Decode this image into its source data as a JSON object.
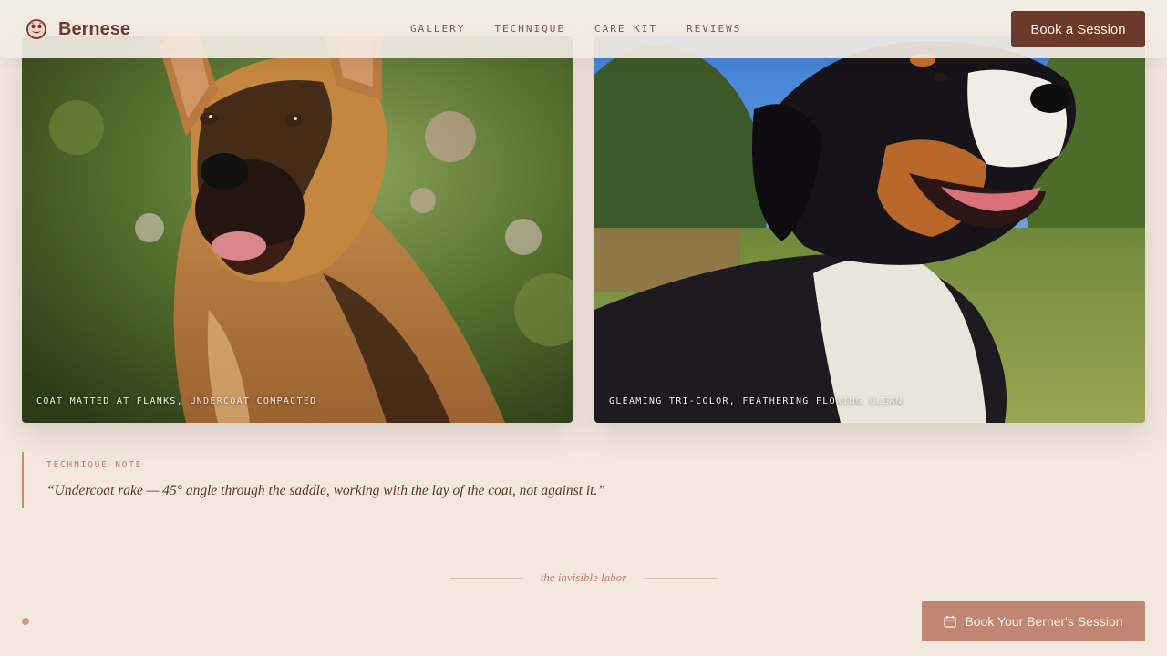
{
  "header": {
    "brand_name": "Bernese",
    "brand_icon": "paw-dog-icon",
    "nav": [
      "GALLERY",
      "TECHNIQUE",
      "CARE KIT",
      "REVIEWS"
    ],
    "book_button": "Book a Session"
  },
  "gallery": {
    "before_caption": "COAT MATTED AT FLANKS, UNDERCOAT COMPACTED",
    "after_caption": "GLEAMING TRI-COLOR, FEATHERING FLOWING CLEAN"
  },
  "technique_note": {
    "label": "TECHNIQUE NOTE",
    "quote": "“Undercoat rake — 45° angle through the saddle, working with the lay of the coat, not against it.”"
  },
  "divider": {
    "text": "the invisible labor"
  },
  "cta": {
    "label": "Book Your Berner's Session",
    "icon": "calendar-icon"
  },
  "colors": {
    "background": "#f2e8de",
    "brand": "#6b3a2c",
    "accent": "#c08672"
  }
}
